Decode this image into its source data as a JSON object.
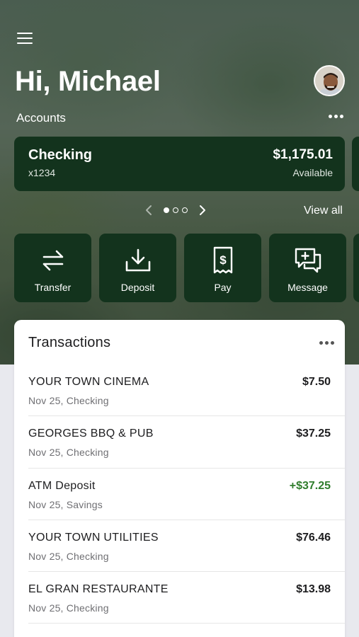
{
  "header": {
    "greeting": "Hi, Michael",
    "menu_icon": "hamburger-menu-icon",
    "avatar_icon": "user-avatar"
  },
  "accounts": {
    "section_label": "Accounts",
    "more_icon": "more-horizontal-icon",
    "card": {
      "name": "Checking",
      "number": "x1234",
      "balance": "$1,175.01",
      "balance_label": "Available"
    },
    "pager": {
      "total": 3,
      "active": 1
    },
    "view_all": "View all"
  },
  "actions": [
    {
      "label": "Transfer",
      "icon": "transfer-arrows-icon"
    },
    {
      "label": "Deposit",
      "icon": "deposit-download-icon"
    },
    {
      "label": "Pay",
      "icon": "pay-bill-icon"
    },
    {
      "label": "Message",
      "icon": "message-add-icon"
    }
  ],
  "transactions": {
    "title": "Transactions",
    "items": [
      {
        "name": "YOUR TOWN CINEMA",
        "sub": "Nov 25, Checking",
        "amount": "$7.50",
        "credit": false
      },
      {
        "name": "GEORGES BBQ & PUB",
        "sub": "Nov 25, Checking",
        "amount": "$37.25",
        "credit": false
      },
      {
        "name": "ATM Deposit",
        "sub": "Nov 25, Savings",
        "amount": "+$37.25",
        "credit": true
      },
      {
        "name": "YOUR TOWN UTILITIES",
        "sub": "Nov 25, Checking",
        "amount": "$76.46",
        "credit": false
      },
      {
        "name": "EL GRAN RESTAURANTE",
        "sub": "Nov 25, Checking",
        "amount": "$13.98",
        "credit": false
      }
    ]
  },
  "colors": {
    "card_green": "#13331d",
    "credit_green": "#2f7d2c",
    "background": "#e8e9ee"
  }
}
